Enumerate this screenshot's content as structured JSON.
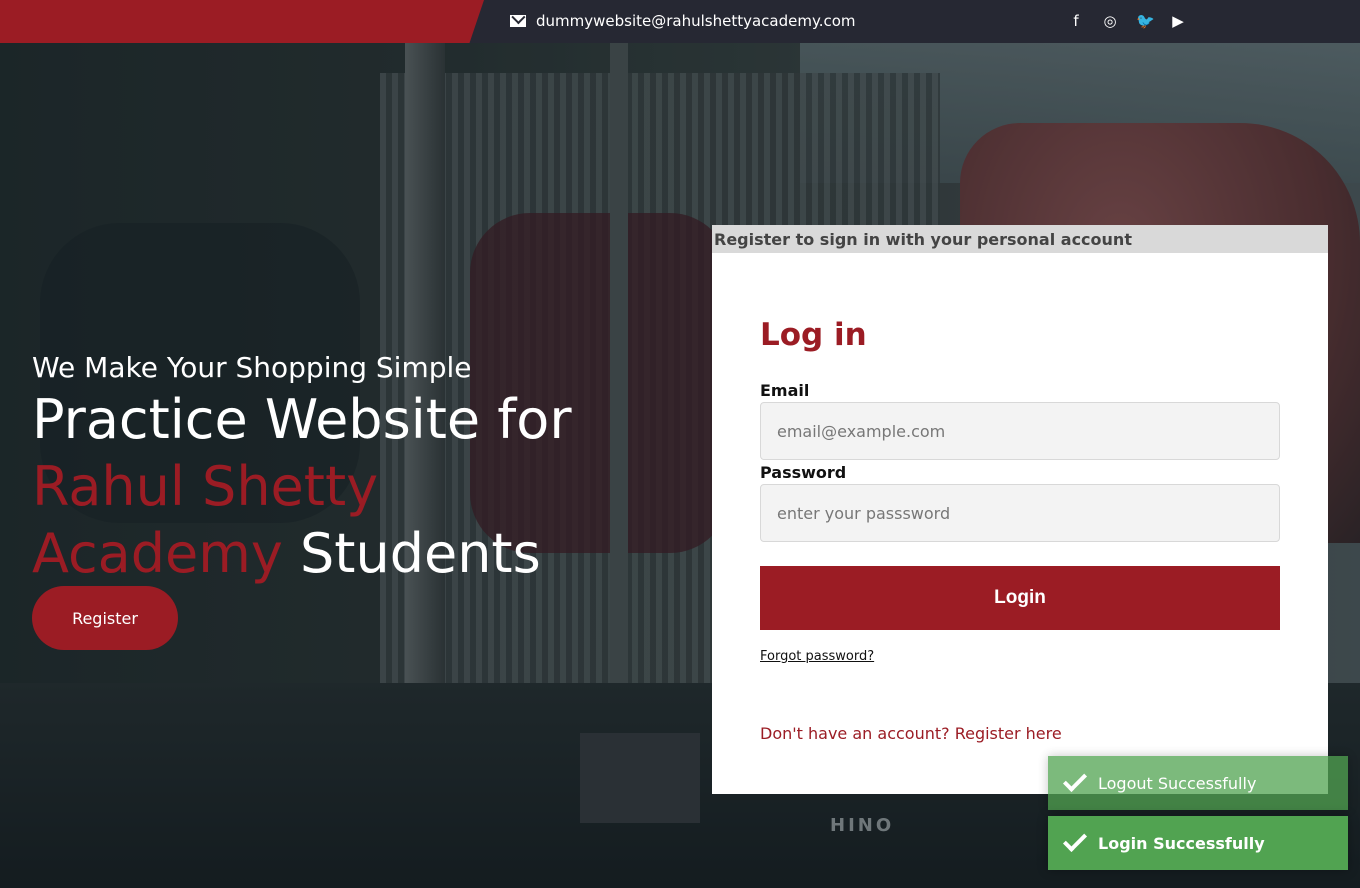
{
  "topbar": {
    "email": "dummywebsite@rahulshettyacademy.com",
    "social_icons": [
      "facebook-icon",
      "instagram-icon",
      "twitter-icon",
      "youtube-icon"
    ],
    "social_glyphs": [
      "f",
      "◎",
      "🐦",
      "▶"
    ]
  },
  "hero": {
    "tagline": "We Make Your Shopping Simple",
    "line1": "Practice Website for",
    "line2": "Rahul Shetty",
    "line3_red": "Academy",
    "line3_white": "Students",
    "register_label": "Register"
  },
  "login": {
    "header": "Register to sign in with your personal account",
    "title": "Log in",
    "email_label": "Email",
    "email_placeholder": "email@example.com",
    "password_label": "Password",
    "password_placeholder": "enter your passsword",
    "login_button": "Login",
    "forgot": "Forgot password?",
    "register_link": "Don't have an account? Register here"
  },
  "background": {
    "watermark": "HINO"
  },
  "toasts": [
    {
      "message": "Logout Successfully"
    },
    {
      "message": "Login Successfully"
    }
  ],
  "colors": {
    "brand_red": "#9b1c24",
    "topbar_dark": "#262833",
    "toast_green": "#51a351"
  }
}
